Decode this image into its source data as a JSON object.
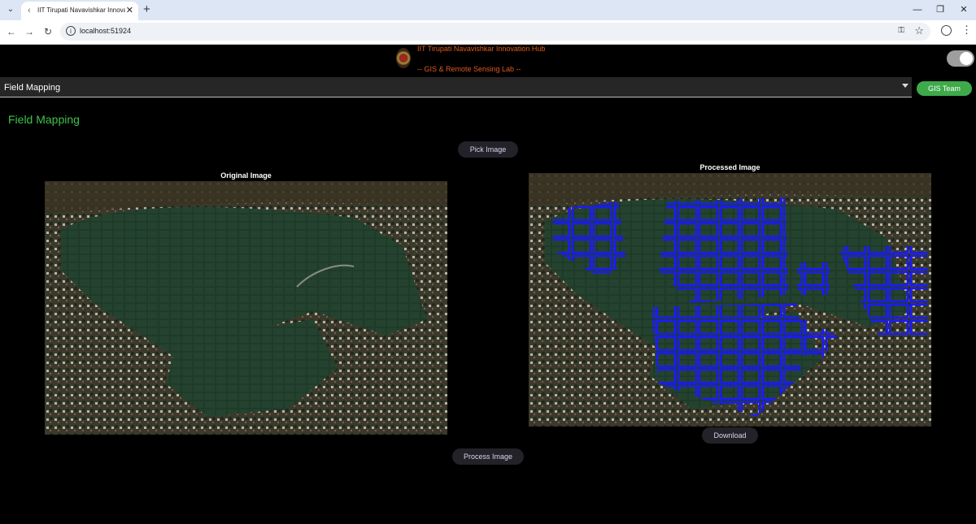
{
  "browser": {
    "tab_title": "IIT Tirupati Navavishkar Innovat",
    "url": "localhost:51924"
  },
  "header": {
    "title": "IIT Tirupati Navavishkar Innovation Hub",
    "subtitle": "-- GIS & Remote Sensing Lab --",
    "theme_toggle_on": true
  },
  "module_select": {
    "value": "Field Mapping"
  },
  "team_button": "GIS Team",
  "page_title": "Field Mapping",
  "pick_image": "Pick Image",
  "original": {
    "label": "Original Image"
  },
  "processed": {
    "label": "Processed Image"
  },
  "download": "Download",
  "process_image": "Process Image",
  "colors": {
    "accent_green": "#3ec24a",
    "header_orange": "#e05a1e",
    "field_outline_blue": "#1a1aff"
  },
  "icons": [
    "search-tabs-icon",
    "favicon-icon",
    "close-icon",
    "new-tab-icon",
    "minimize-icon",
    "restore-icon",
    "window-close-icon",
    "back-icon",
    "forward-icon",
    "reload-icon",
    "site-info-icon",
    "password-key-icon",
    "bookmark-star-icon",
    "profile-icon",
    "menu-icon",
    "dropdown-arrow-icon",
    "logo-icon"
  ]
}
